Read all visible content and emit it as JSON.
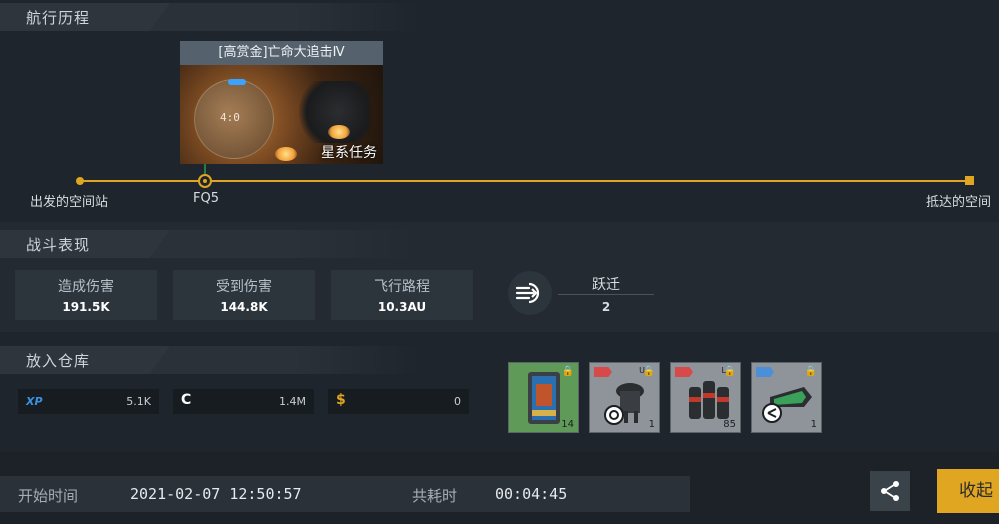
{
  "sections": {
    "journey": "航行历程",
    "combat": "战斗表现",
    "warehouse": "放入仓库"
  },
  "journey": {
    "origin": "出发的空间站",
    "waypoint": "FQ5",
    "destination": "抵达的空间",
    "mission": {
      "title": "[高赏金]亡命大追击Ⅳ",
      "timer": "4:0",
      "tag": "星系任务"
    }
  },
  "combat": {
    "stats": [
      {
        "label": "造成伤害",
        "value": "191.5K"
      },
      {
        "label": "受到伤害",
        "value": "144.8K"
      },
      {
        "label": "飞行路程",
        "value": "10.3AU"
      }
    ],
    "jump": {
      "label": "跃迁",
      "value": "2"
    }
  },
  "warehouse": {
    "resources": [
      {
        "icon": "XP",
        "value": "5.1K",
        "color": "#3d8fe0"
      },
      {
        "icon": "C",
        "value": "1.4M",
        "color": "#ffffff"
      },
      {
        "icon": "$",
        "value": "0",
        "color": "#e0a521"
      }
    ],
    "items": [
      {
        "icon": "fridge-module-icon",
        "count": "14",
        "tier": "",
        "bg": "#5f9a58"
      },
      {
        "icon": "turret-module-icon",
        "count": "1",
        "tier": "U",
        "bg": "#8e9499"
      },
      {
        "icon": "cylinder-module-icon",
        "count": "85",
        "tier": "L",
        "bg": "#8e9499"
      },
      {
        "icon": "missile-module-icon",
        "count": "1",
        "tier": "",
        "bg": "#8e9499"
      }
    ]
  },
  "footer": {
    "start_label": "开始时间",
    "start_value": "2021-02-07 12:50:57",
    "duration_label": "共耗时",
    "duration_value": "00:04:45",
    "collect_label": "收起"
  },
  "colors": {
    "accent": "#e0a521",
    "background": "#1f252c"
  }
}
